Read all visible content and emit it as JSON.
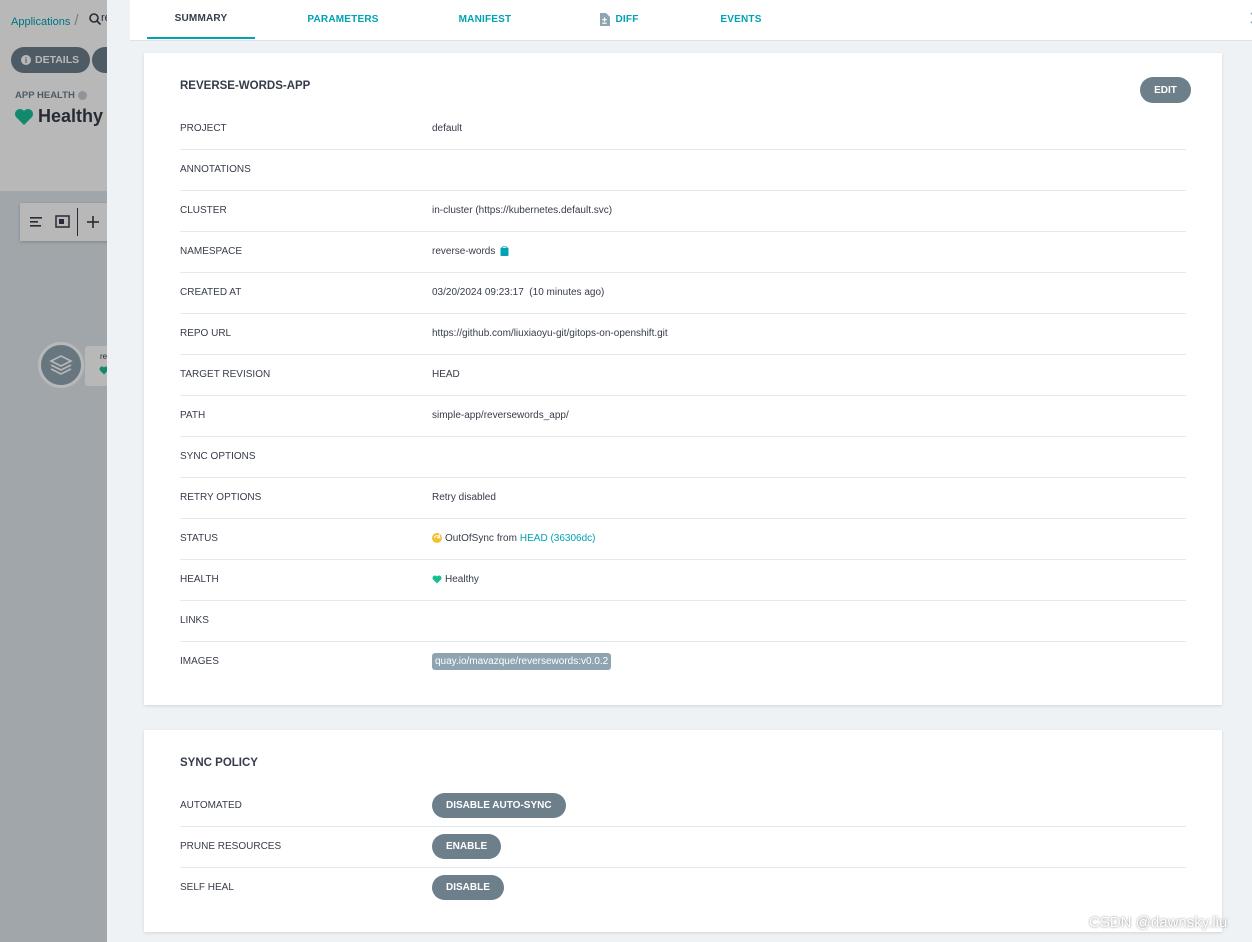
{
  "background": {
    "breadcrumb": "Applications",
    "search_text": "re",
    "details_button": "DETAILS",
    "app_health_label": "APP HEALTH",
    "app_health_value": "Healthy",
    "node_label": "re"
  },
  "tabs": [
    {
      "label": "SUMMARY",
      "active": true
    },
    {
      "label": "PARAMETERS",
      "active": false
    },
    {
      "label": "MANIFEST",
      "active": false
    },
    {
      "label": "DIFF",
      "active": false
    },
    {
      "label": "EVENTS",
      "active": false
    }
  ],
  "summary": {
    "title": "REVERSE-WORDS-APP",
    "edit_label": "EDIT",
    "rows": {
      "project": {
        "label": "PROJECT",
        "value": "default"
      },
      "annotations": {
        "label": "ANNOTATIONS",
        "value": ""
      },
      "cluster": {
        "label": "CLUSTER",
        "value": "in-cluster (https://kubernetes.default.svc)"
      },
      "namespace": {
        "label": "NAMESPACE",
        "value": "reverse-words"
      },
      "created_at": {
        "label": "CREATED AT",
        "value": "03/20/2024 09:23:17  (10 minutes ago)"
      },
      "repo_url": {
        "label": "REPO URL",
        "value": "https://github.com/liuxiaoyu-git/gitops-on-openshift.git"
      },
      "target_revision": {
        "label": "TARGET REVISION",
        "value": "HEAD"
      },
      "path": {
        "label": "PATH",
        "value": "simple-app/reversewords_app/"
      },
      "sync_options": {
        "label": "SYNC OPTIONS",
        "value": ""
      },
      "retry_options": {
        "label": "RETRY OPTIONS",
        "value": "Retry disabled"
      },
      "status": {
        "label": "STATUS",
        "state": "OutOfSync",
        "from": "from",
        "revision": "HEAD (36306dc)"
      },
      "health": {
        "label": "HEALTH",
        "value": "Healthy"
      },
      "links": {
        "label": "LINKS",
        "value": ""
      },
      "images": {
        "label": "IMAGES",
        "value": "quay.io/mavazque/reversewords:v0.0.2"
      }
    }
  },
  "sync_policy": {
    "title": "SYNC POLICY",
    "rows": {
      "automated": {
        "label": "AUTOMATED",
        "button": "DISABLE AUTO-SYNC"
      },
      "prune": {
        "label": "PRUNE RESOURCES",
        "button": "ENABLE"
      },
      "self_heal": {
        "label": "SELF HEAL",
        "button": "DISABLE"
      }
    }
  },
  "watermark": "CSDN @dawnsky.liu",
  "colors": {
    "accent": "#00a2b3",
    "healthy": "#18be94",
    "out_of_sync": "#f4c030",
    "button": "#6d7f8b"
  },
  "icons": [
    "search-icon",
    "info-icon",
    "heart-icon",
    "diff-file-icon",
    "close-icon",
    "clipboard-icon",
    "out-of-sync-icon",
    "layers-icon",
    "align-left-icon",
    "image-icon",
    "plus-icon"
  ]
}
